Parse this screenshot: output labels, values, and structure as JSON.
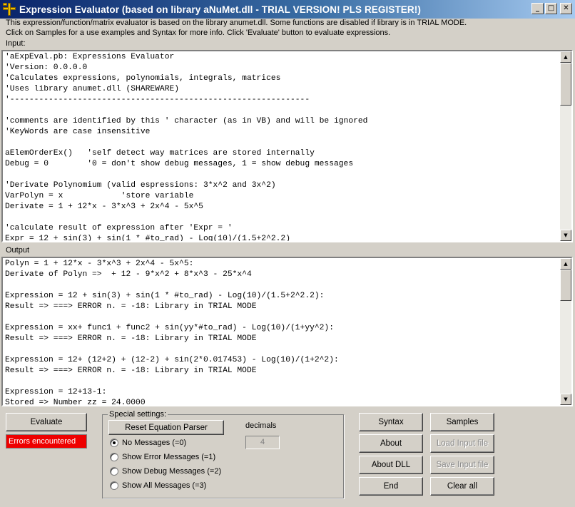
{
  "window": {
    "title": "Expression Evaluator (based on library aNuMet.dll - TRIAL VERSION! PLS REGISTER!)",
    "minimize_glyph": "_",
    "maximize_glyph": "□",
    "close_glyph": "✕"
  },
  "info_lines": [
    "This expression/function/matrix evaluator is based on the library anumet.dll. Some functions are disabled if library is in TRIAL MODE.",
    "Click on Samples for a use examples and Syntax for more info. Click 'Evaluate' button to evaluate expressions."
  ],
  "input": {
    "label": "Input:",
    "text": "'aExpEval.pb: Expressions Evaluator\n'Version: 0.0.0.0\n'Calculates expressions, polynomials, integrals, matrices\n'Uses library anumet.dll (SHAREWARE)\n'--------------------------------------------------------------\n\n'comments are identified by this ' character (as in VB) and will be ignored\n'KeyWords are case insensitive\n\naElemOrderEx()   'self detect way matrices are stored internally\nDebug = 0        '0 = don't show debug messages, 1 = show debug messages\n\n'Derivate Polynomium (valid espressions: 3*x^2 and 3x^2)\nVarPolyn = x            'store variable\nDerivate = 1 + 12*x - 3*x^3 + 2x^4 - 5x^5\n\n'calculate result of expression after 'Expr = '\nExpr = 12 + sin(3) + sin(1 * #to_rad) - Log(10)/(1.5+2^2.2)"
  },
  "output": {
    "label": "Output",
    "text": "Polyn = 1 + 12*x - 3*x^3 + 2x^4 - 5x^5:\nDerivate of Polyn =>  + 12 - 9*x^2 + 8*x^3 - 25*x^4\n\nExpression = 12 + sin(3) + sin(1 * #to_rad) - Log(10)/(1.5+2^2.2):\nResult => ===> ERROR n. = -18: Library in TRIAL MODE\n\nExpression = xx+ func1 + func2 + sin(yy*#to_rad) - Log(10)/(1+yy^2):\nResult => ===> ERROR n. = -18: Library in TRIAL MODE\n\nExpression = 12+ (12+2) + (12-2) + sin(2*0.017453) - Log(10)/(1+2^2):\nResult => ===> ERROR n. = -18: Library in TRIAL MODE\n\nExpression = 12+13-1:\nStored => Number zz = 24.0000"
  },
  "buttons": {
    "evaluate": "Evaluate",
    "reset_parser": "Reset Equation Parser",
    "syntax": "Syntax",
    "samples": "Samples",
    "about": "About",
    "load_input": "Load Input file",
    "about_dll": "About DLL",
    "save_input": "Save Input file",
    "end": "End",
    "clear_all": "Clear all"
  },
  "status": {
    "error": "Errors encountered",
    "error_color": "#ee0000"
  },
  "special_settings": {
    "legend": "Special settings:",
    "decimals_label": "decimals",
    "decimals_value": "4",
    "options": [
      {
        "label": "No Messages (=0)",
        "checked": true
      },
      {
        "label": "Show Error Messages (=1)",
        "checked": false
      },
      {
        "label": "Show Debug Messages (=2)",
        "checked": false
      },
      {
        "label": "Show All Messages (=3)",
        "checked": false
      }
    ]
  },
  "scroll_arrows": {
    "up": "▲",
    "down": "▼"
  },
  "colors": {
    "titlebar_start": "#0a246a",
    "titlebar_end": "#a6caf0",
    "face": "#d4d0c8"
  }
}
